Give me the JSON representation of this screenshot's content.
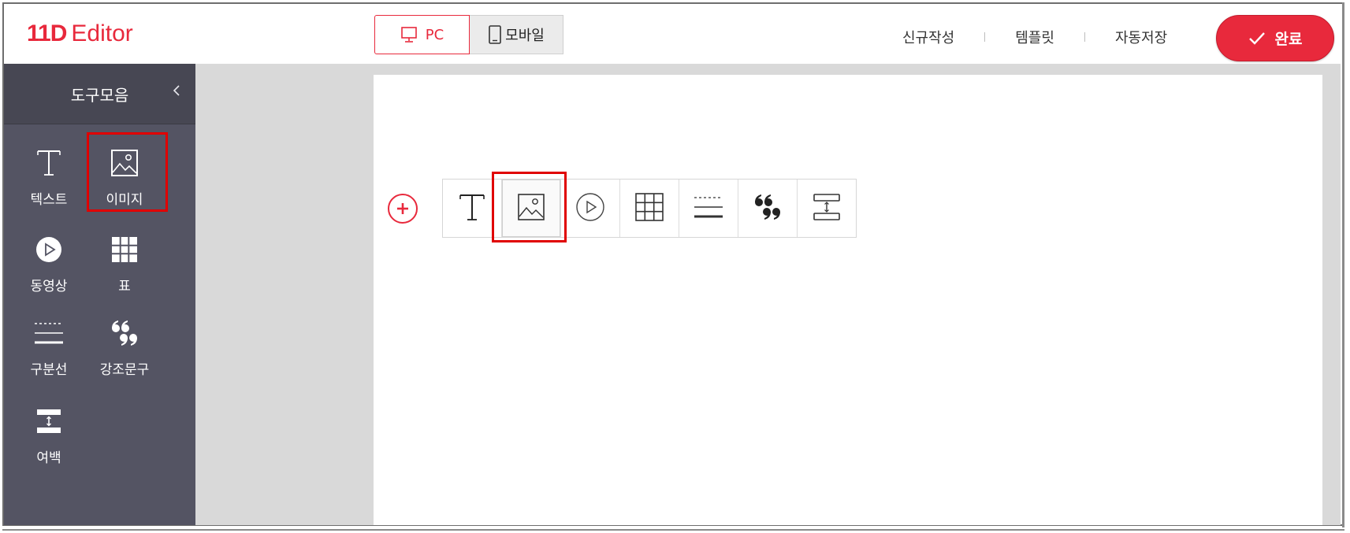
{
  "header": {
    "logo_mark": "11D",
    "logo_text": "Editor",
    "device_toggle": {
      "pc_label": "PC",
      "mobile_label": "모바일",
      "selected": "PC"
    },
    "links": [
      "신규작성",
      "템플릿",
      "자동저장"
    ],
    "done_label": "완료"
  },
  "sidebar": {
    "title": "도구모음",
    "tools": [
      {
        "label": "텍스트",
        "icon": "text-icon"
      },
      {
        "label": "이미지",
        "icon": "image-icon",
        "highlighted": true
      },
      {
        "label": "동영상",
        "icon": "play-icon"
      },
      {
        "label": "표",
        "icon": "table-icon"
      },
      {
        "label": "구분선",
        "icon": "divider-icon"
      },
      {
        "label": "강조문구",
        "icon": "quote-icon"
      },
      {
        "label": "여백",
        "icon": "spacing-icon"
      }
    ]
  },
  "insert_toolbar": {
    "items": [
      "text-icon",
      "image-icon",
      "play-icon",
      "table-icon",
      "divider-icon",
      "quote-icon",
      "spacing-icon"
    ],
    "highlighted": "image-icon"
  },
  "colors": {
    "accent": "#e8293c",
    "sidebar_bg": "#545463",
    "sidebar_head_bg": "#474753",
    "canvas_bg": "#d9d9d9",
    "highlight_box": "#e00000"
  }
}
